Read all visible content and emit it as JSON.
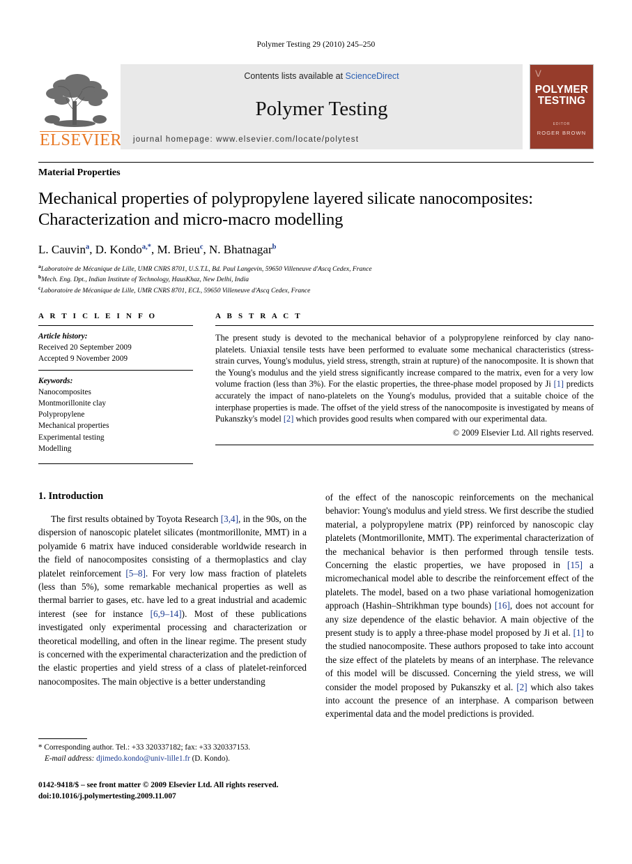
{
  "running_head": "Polymer Testing 29 (2010) 245–250",
  "masthead": {
    "contents_prefix": "Contents lists available at ",
    "sciencedirect": "ScienceDirect",
    "journal_name": "Polymer Testing",
    "homepage": "journal homepage: www.elsevier.com/locate/polytest",
    "publisher_name": "ELSEVIER",
    "accent_orange": "#E87722",
    "cover": {
      "title_line1": "POLYMER",
      "title_line2": "TESTING",
      "editor_label": "EDITOR",
      "editor": "ROGER BROWN",
      "background": "#963c2b"
    }
  },
  "article": {
    "section_label": "Material Properties",
    "title_line1": "Mechanical properties of polypropylene layered silicate nanocomposites:",
    "title_line2": "Characterization and micro-macro modelling",
    "authors": [
      {
        "name": "L. Cauvin",
        "sup": "a",
        "sep": ", "
      },
      {
        "name": "D. Kondo",
        "sup": "a,*",
        "sep": ", "
      },
      {
        "name": "M. Brieu",
        "sup": "c",
        "sep": ", "
      },
      {
        "name": "N. Bhatnagar",
        "sup": "b",
        "sep": ""
      }
    ],
    "affiliations": [
      {
        "mark": "a",
        "text": "Laboratoire de Mécanique de Lille, UMR CNRS 8701, U.S.T.L, Bd. Paul Langevin, 59650 Villeneuve d'Ascq Cedex, France"
      },
      {
        "mark": "b",
        "text": "Mech. Eng. Dpt., Indian Institute of Technology, HausKhaz, New Delhi, India"
      },
      {
        "mark": "c",
        "text": "Laboratoire de Mécanique de Lille, UMR CNRS 8701, ECL, 59650 Villeneuve d'Ascq Cedex, France"
      }
    ]
  },
  "article_info": {
    "heading": "A R T I C L E  I N F O",
    "history_label": "Article history:",
    "history": [
      "Received 20 September 2009",
      "Accepted 9 November 2009"
    ],
    "keywords_label": "Keywords:",
    "keywords": [
      "Nanocomposites",
      "Montmorillonite clay",
      "Polypropylene",
      "Mechanical properties",
      "Experimental testing",
      "Modelling"
    ]
  },
  "abstract": {
    "heading": "A B S T R A C T",
    "part1": "The present study is devoted to the mechanical behavior of a polypropylene reinforced by clay nano-platelets. Uniaxial tensile tests have been performed to evaluate some mechanical characteristics (stress-strain curves, Young's modulus, yield stress, strength, strain at rupture) of the nanocomposite. It is shown that the Young's modulus and the yield stress significantly increase compared to the matrix, even for a very low volume fraction (less than 3%). For the elastic properties, the three-phase model proposed by Ji ",
    "ref1": "[1]",
    "part2": " predicts accurately the impact of nano-platelets on the Young's modulus, provided that a suitable choice of the interphase properties is made. The offset of the yield stress of the nanocomposite is investigated by means of Pukanszky's model ",
    "ref2": "[2]",
    "part3": " which provides good results when compared with our experimental data.",
    "copyright": "© 2009 Elsevier Ltd. All rights reserved."
  },
  "introduction": {
    "heading": "1. Introduction",
    "left": {
      "p1_a": "The first results obtained by Toyota Research ",
      "p1_ref1": "[3,4]",
      "p1_b": ", in the 90s, on the dispersion of nanoscopic platelet silicates (montmorillonite, MMT) in a polyamide 6 matrix have induced considerable worldwide research in the field of nanocomposites consisting of a thermoplastics and clay platelet reinforcement ",
      "p1_ref2": "[5–8]",
      "p1_c": ". For very low mass fraction of platelets (less than 5%), some remarkable mechanical properties as well as thermal barrier to gases, etc. have led to a great industrial and academic interest (see for instance ",
      "p1_ref3": "[6,9–14]",
      "p1_d": "). Most of these publications investigated only experimental processing and characterization or theoretical modelling, and often in the linear regime. The present study is concerned with the experimental characterization and the prediction of the elastic properties and yield stress of a class of platelet-reinforced nanocomposites. The main objective is a better understanding"
    },
    "right": {
      "p_a": "of the effect of the nanoscopic reinforcements on the mechanical behavior: Young's modulus and yield stress. We first describe the studied material, a polypropylene matrix (PP) reinforced by nanoscopic clay platelets (Montmorillonite, MMT). The experimental characterization of the mechanical behavior is then performed through tensile tests. Concerning the elastic properties, we have proposed in ",
      "p_ref1": "[15]",
      "p_b": " a micromechanical model able to describe the reinforcement effect of the platelets. The model, based on a two phase variational homogenization approach (Hashin–Shtrikhman type bounds) ",
      "p_ref2": "[16]",
      "p_c": ", does not account for any size dependence of the elastic behavior. A main objective of the present study is to apply a three-phase model proposed by Ji et al. ",
      "p_ref3": "[1]",
      "p_d": " to the studied nanocomposite. These authors proposed to take into account the size effect of the platelets by means of an interphase. The relevance of this model will be discussed. Concerning the yield stress, we will consider the model proposed by Pukanszky et al. ",
      "p_ref4": "[2]",
      "p_e": " which also takes into account the presence of an interphase. A comparison between experimental data and the model predictions is provided."
    }
  },
  "footnote": {
    "star": "*",
    "corresponding": " Corresponding author. Tel.: +33 320337182; fax: +33 320337153.",
    "email_label": "E-mail address:",
    "email": "djimedo.kondo@univ-lille1.fr",
    "email_suffix": " (D. Kondo)."
  },
  "page_footer": {
    "line1": "0142-9418/$ – see front matter © 2009 Elsevier Ltd. All rights reserved.",
    "line2": "doi:10.1016/j.polymertesting.2009.11.007"
  }
}
